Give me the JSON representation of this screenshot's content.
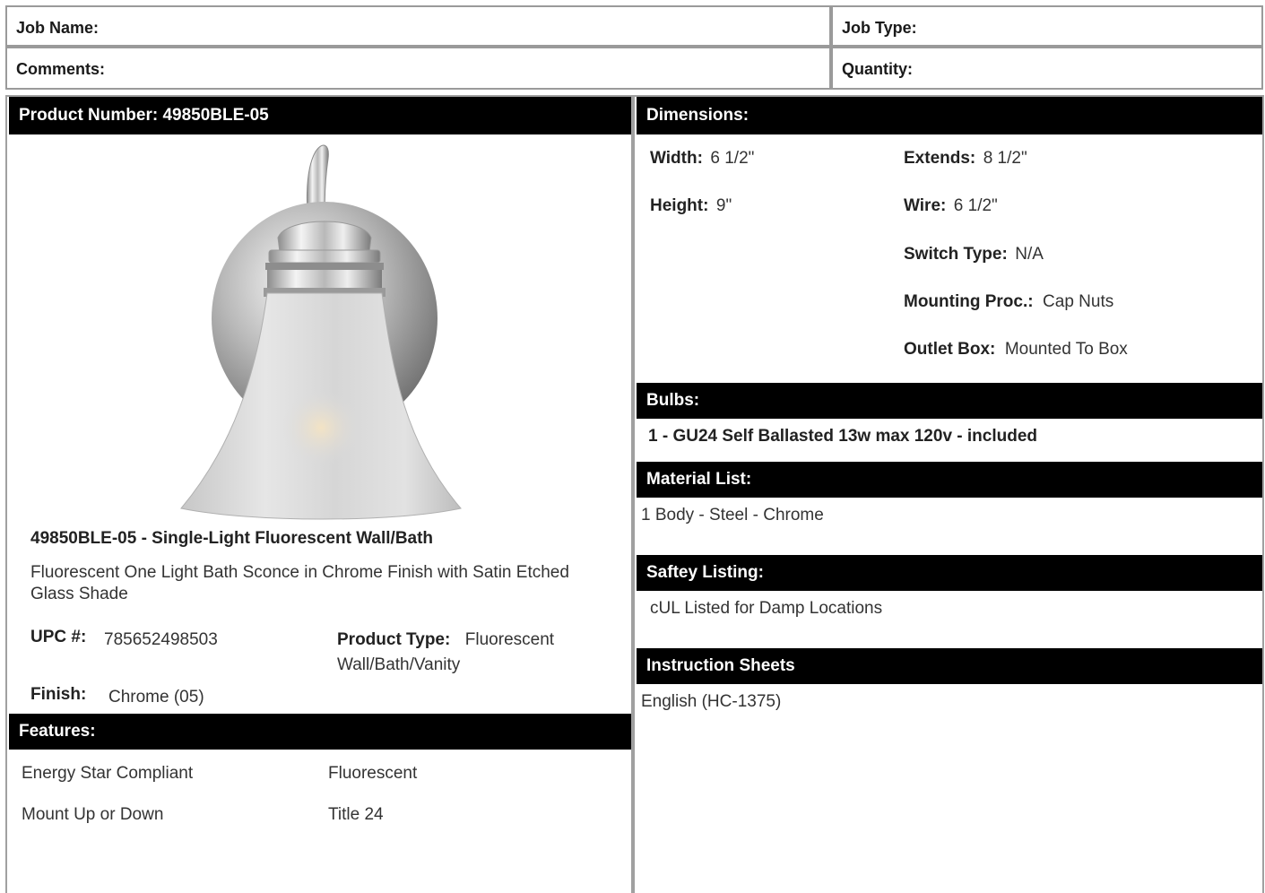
{
  "job": {
    "name_label": "Job Name:",
    "type_label": "Job Type:",
    "comments_label": "Comments:",
    "quantity_label": "Quantity:"
  },
  "product": {
    "header": "Product Number: 49850BLE-05",
    "title": "49850BLE-05 - Single-Light Fluorescent Wall/Bath",
    "description": "Fluorescent One Light Bath Sconce in Chrome Finish with Satin Etched Glass Shade",
    "upc_label": "UPC #:",
    "upc_value": "785652498503",
    "type_label": "Product Type:",
    "type_value": "Fluorescent Wall/Bath/Vanity",
    "finish_label": "Finish:",
    "finish_value": "Chrome (05)",
    "image_icon": "wall-sconce-photo"
  },
  "features": {
    "header": "Features:",
    "items": [
      "Energy Star Compliant",
      "Fluorescent",
      "Mount Up or Down",
      "Title 24"
    ]
  },
  "dimensions": {
    "header": "Dimensions:",
    "width_label": "Width:",
    "width_value": "6 1/2\"",
    "height_label": "Height:",
    "height_value": "9\"",
    "extends_label": "Extends:",
    "extends_value": "8 1/2\"",
    "wire_label": "Wire:",
    "wire_value": "6 1/2\"",
    "switch_label": "Switch Type:",
    "switch_value": "N/A",
    "mounting_label": "Mounting Proc.:",
    "mounting_value": "Cap Nuts",
    "outlet_label": "Outlet Box:",
    "outlet_value": "Mounted To Box"
  },
  "bulbs": {
    "header": "Bulbs:",
    "value": "1 - GU24 Self Ballasted 13w max 120v - included"
  },
  "materials": {
    "header": "Material List:",
    "value": "1 Body - Steel - Chrome"
  },
  "safety": {
    "header": "Saftey Listing:",
    "value": "cUL Listed for Damp Locations"
  },
  "instructions": {
    "header": "Instruction Sheets",
    "value": "English (HC-1375)"
  }
}
